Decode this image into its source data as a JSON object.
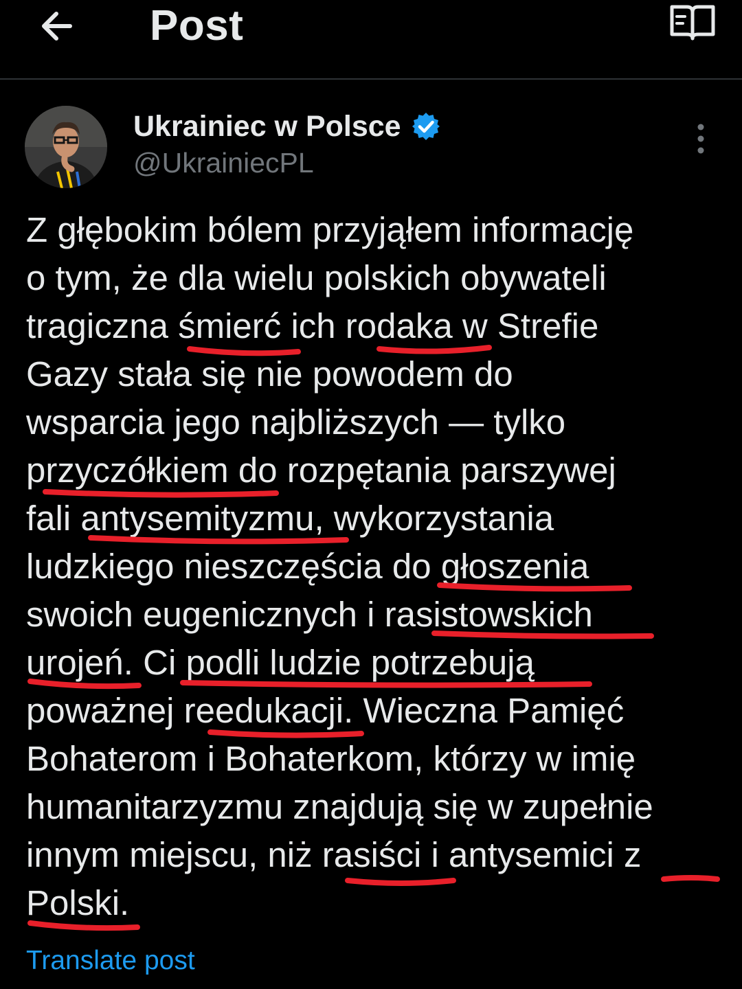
{
  "header": {
    "title": "Post",
    "back_icon": "arrow-left-icon",
    "reader_icon": "book-open-icon"
  },
  "author": {
    "name": "Ukrainiec w Polsce",
    "handle": "@UkrainiecPL",
    "verified": true,
    "verified_color": "#1d9bf0",
    "more_icon": "more-vertical-icon"
  },
  "post": {
    "lines": [
      "Z głębokim bólem przyjąłem informację",
      "o tym, że dla wielu polskich obywateli",
      "tragiczna śmierć ich rodaka w Strefie",
      "Gazy stała się nie powodem do",
      "wsparcia jego najbliższych — tylko",
      "przyczółkiem do rozpętania parszywej",
      "fali antysemityzmu, wykorzystania",
      "ludzkiego nieszczęścia do głoszenia",
      "swoich eugenicznych i rasistowskich",
      "urojeń. Ci podli ludzie potrzebują",
      "poważnej reedukacji. Wieczna Pamięć",
      "Bohaterom i Bohaterkom, którzy w imię",
      "humanitarzyzmu znajdują się w zupełnie",
      "innym miejscu, niż rasiści i antysemici z",
      "Polski."
    ],
    "translate_label": "Translate post"
  },
  "colors": {
    "background": "#000000",
    "text": "#e7e9ea",
    "secondary_text": "#71767b",
    "link": "#1d9bf0",
    "underline_annotation": "#e8202a",
    "divider": "#2f3336"
  }
}
